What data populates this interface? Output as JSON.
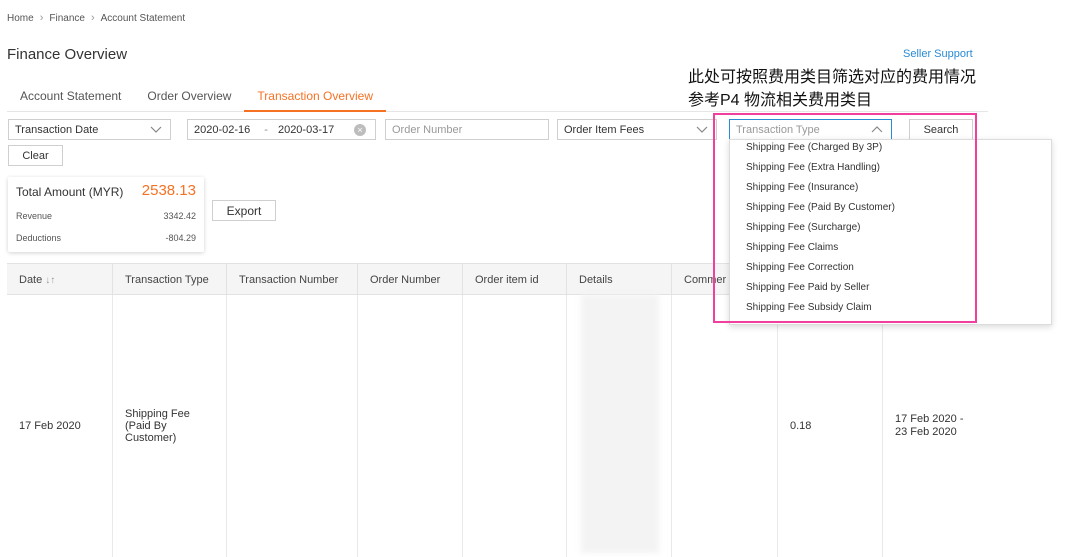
{
  "breadcrumb": [
    "Home",
    "Finance",
    "Account Statement"
  ],
  "page_title": "Finance Overview",
  "seller_support": "Seller Support",
  "annotation": {
    "line1": "此处可按照费用类目筛选对应的费用情况",
    "line2": "参考P4 物流相关费用类目"
  },
  "tabs": [
    {
      "label": "Account Statement",
      "active": false
    },
    {
      "label": "Order Overview",
      "active": false
    },
    {
      "label": "Transaction Overview",
      "active": true
    }
  ],
  "filters": {
    "date_type": "Transaction Date",
    "date_start": "2020-02-16",
    "date_sep": "-",
    "date_end": "2020-03-17",
    "order_number_placeholder": "Order Number",
    "fee_category": "Order Item Fees",
    "transaction_type_placeholder": "Transaction Type",
    "search_label": "Search",
    "clear_label": "Clear"
  },
  "summary": {
    "total_label": "Total Amount (MYR)",
    "total_value": "2538.13",
    "revenue_label": "Revenue",
    "revenue_value": "3342.42",
    "deductions_label": "Deductions",
    "deductions_value": "-804.29"
  },
  "export_label": "Export",
  "table": {
    "columns": [
      "Date",
      "Transaction Type",
      "Transaction Number",
      "Order Number",
      "Order item id",
      "Details",
      "Commer"
    ],
    "row": {
      "date": "17 Feb 2020",
      "transaction_type": "Shipping Fee (Paid By Customer)",
      "amount": "0.18",
      "period": "17 Feb 2020 - 23 Feb 2020"
    }
  },
  "dropdown_options": [
    "Shipping Fee (Charged By 3P)",
    "Shipping Fee (Extra Handling)",
    "Shipping Fee (Insurance)",
    "Shipping Fee (Paid By Customer)",
    "Shipping Fee (Surcharge)",
    "Shipping Fee Claims",
    "Shipping Fee Correction",
    "Shipping Fee Paid by Seller",
    "Shipping Fee Subsidy Claim"
  ],
  "colors": {
    "accent": "#f57224",
    "link": "#2a8ad4",
    "highlight": "#f03f9c"
  }
}
